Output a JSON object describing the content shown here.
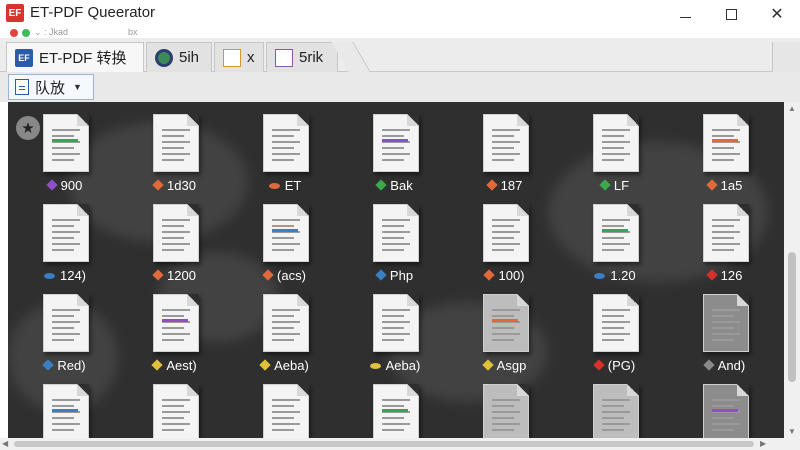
{
  "window": {
    "title": "ET-PDF Queerator",
    "logo_text": "EF",
    "minimize": "minimize",
    "maximize": "maximize",
    "close": "✕",
    "sub_ghost_left": "⌄ : Jkad",
    "sub_ghost_right": "bx"
  },
  "tabs": [
    {
      "label": "ET-PDF 转换",
      "icon": "ef-logo-icon",
      "icon_text": "EF",
      "active": true
    },
    {
      "label": "5ih",
      "icon": "gear-icon",
      "icon_text": "",
      "active": false
    },
    {
      "label": "x",
      "icon": "document-icon",
      "icon_text": "",
      "active": false
    },
    {
      "label": "5rik",
      "icon": "document-icon",
      "icon_text": "",
      "active": false
    }
  ],
  "toolbar": {
    "sort_label": "队放",
    "sort_icon": "list-document-icon",
    "caret": "▼"
  },
  "grid": {
    "star_icon": "★",
    "items": [
      {
        "label": "900",
        "tag_color": "#8e4fc9",
        "shade": "light"
      },
      {
        "label": "1d30",
        "tag_color": "#e06a3a",
        "shade": "light"
      },
      {
        "label": "ET",
        "tag_color": "#e06a3a",
        "shade": "light"
      },
      {
        "label": "Bak",
        "tag_color": "#3ba84a",
        "shade": "light"
      },
      {
        "label": "187",
        "tag_color": "#e06a3a",
        "shade": "light"
      },
      {
        "label": "LF",
        "tag_color": "#3ba84a",
        "shade": "light"
      },
      {
        "label": "1a5",
        "tag_color": "#e06a3a",
        "shade": "light"
      },
      {
        "label": "124)",
        "tag_color": "#3a7fc4",
        "shade": "light"
      },
      {
        "label": "1200",
        "tag_color": "#e06a3a",
        "shade": "light"
      },
      {
        "label": "(acs)",
        "tag_color": "#e06a3a",
        "shade": "light"
      },
      {
        "label": "Php",
        "tag_color": "#3a7fc4",
        "shade": "light"
      },
      {
        "label": "100)",
        "tag_color": "#e06a3a",
        "shade": "light"
      },
      {
        "label": "1.20",
        "tag_color": "#3a7fc4",
        "shade": "light"
      },
      {
        "label": "126",
        "tag_color": "#d8302a",
        "shade": "light"
      },
      {
        "label": "Red)",
        "tag_color": "#3a7fc4",
        "shade": "light"
      },
      {
        "label": "Aest)",
        "tag_color": "#e0c23a",
        "shade": "light"
      },
      {
        "label": "Aeba)",
        "tag_color": "#e0c23a",
        "shade": "light"
      },
      {
        "label": "Aeba)",
        "tag_color": "#e0c23a",
        "shade": "light"
      },
      {
        "label": "Asgp",
        "tag_color": "#e0c23a",
        "shade": "gray"
      },
      {
        "label": "(PG)",
        "tag_color": "#d8302a",
        "shade": "light"
      },
      {
        "label": "And)",
        "tag_color": "#8a8a8a",
        "shade": "dark"
      },
      {
        "label": "",
        "tag_color": "#3ba84a",
        "shade": "light"
      },
      {
        "label": "",
        "tag_color": "#e0c23a",
        "shade": "light"
      },
      {
        "label": "",
        "tag_color": "#e0c23a",
        "shade": "light"
      },
      {
        "label": "",
        "tag_color": "#3ba84a",
        "shade": "light"
      },
      {
        "label": "",
        "tag_color": "#e0c23a",
        "shade": "gray"
      },
      {
        "label": "",
        "tag_color": "#d8302a",
        "shade": "gray"
      },
      {
        "label": "",
        "tag_color": "#8a8a8a",
        "shade": "dark"
      }
    ]
  },
  "colors": {
    "grid_bg": "#2f2f2f",
    "accent": "#2a5da8",
    "close_red": "#d9342b"
  }
}
